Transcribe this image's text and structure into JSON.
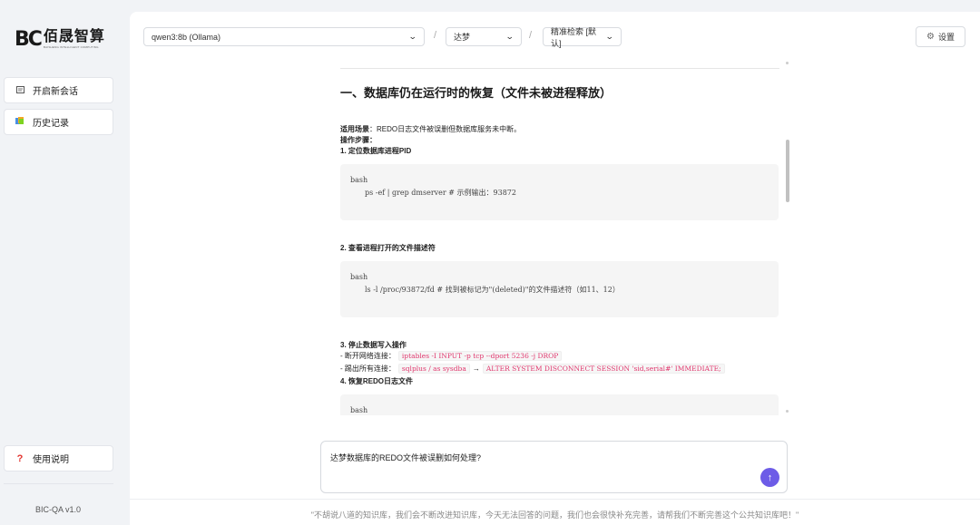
{
  "sidebar": {
    "logo_mark": "BC",
    "logo_cn": "佰晟智算",
    "logo_en": "BAISHENG INTELLIGENT COMPUTING",
    "new_chat": "开启新会话",
    "history": "历史记录",
    "help": "使用说明",
    "version": "BIC-QA v1.0",
    "icons": {
      "new_chat": "chat-icon",
      "history": "history-icon",
      "help": "question-icon"
    }
  },
  "topbar": {
    "model": "qwen3:8b (Ollama)",
    "db": "达梦",
    "search_mode": "精准检索 [默认]",
    "separator": "/",
    "settings": "设置"
  },
  "answer": {
    "heading": "一、数据库仍在运行时的恢复（文件未被进程释放）",
    "scene_label": "适用场景",
    "scene_text": "：REDO日志文件被误删但数据库服务未中断。",
    "steps_label": "操作步骤",
    "steps_colon": "：",
    "step1": "1. 定位数据库进程PID",
    "code1_lang": "bash",
    "code1": "ps -ef | grep dmserver  # 示例输出：93872",
    "step2": "2. 查看进程打开的文件描述符",
    "code2_lang": "bash",
    "code2": "ls -l /proc/93872/fd  # 找到被标记为\"(deleted)\"的文件描述符（如11、12）",
    "step3": "3. 停止数据写入操作",
    "net_label": "- 断开网络连接：",
    "net_code": "iptables -I INPUT -p tcp --dport 5236 -j DROP",
    "sess_label": "- 踢出所有连接：",
    "sess_code1": "sqlplus / as sysdba",
    "sess_arrow": "→",
    "sess_code2": "ALTER SYSTEM DISCONNECT SESSION 'sid,serial#' IMMEDIATE;",
    "step4": "4. 恢复REDO日志文件",
    "code3_lang": "bash"
  },
  "input": {
    "value": "达梦数据库的REDO文件被误删如何处理?",
    "send_icon": "arrow-up-icon"
  },
  "footer": "\"不胡说八道的知识库，我们会不断改进知识库，今天无法回答的问题，我们也会很快补充完善，请帮我们不断完善这个公共知识库吧！\""
}
